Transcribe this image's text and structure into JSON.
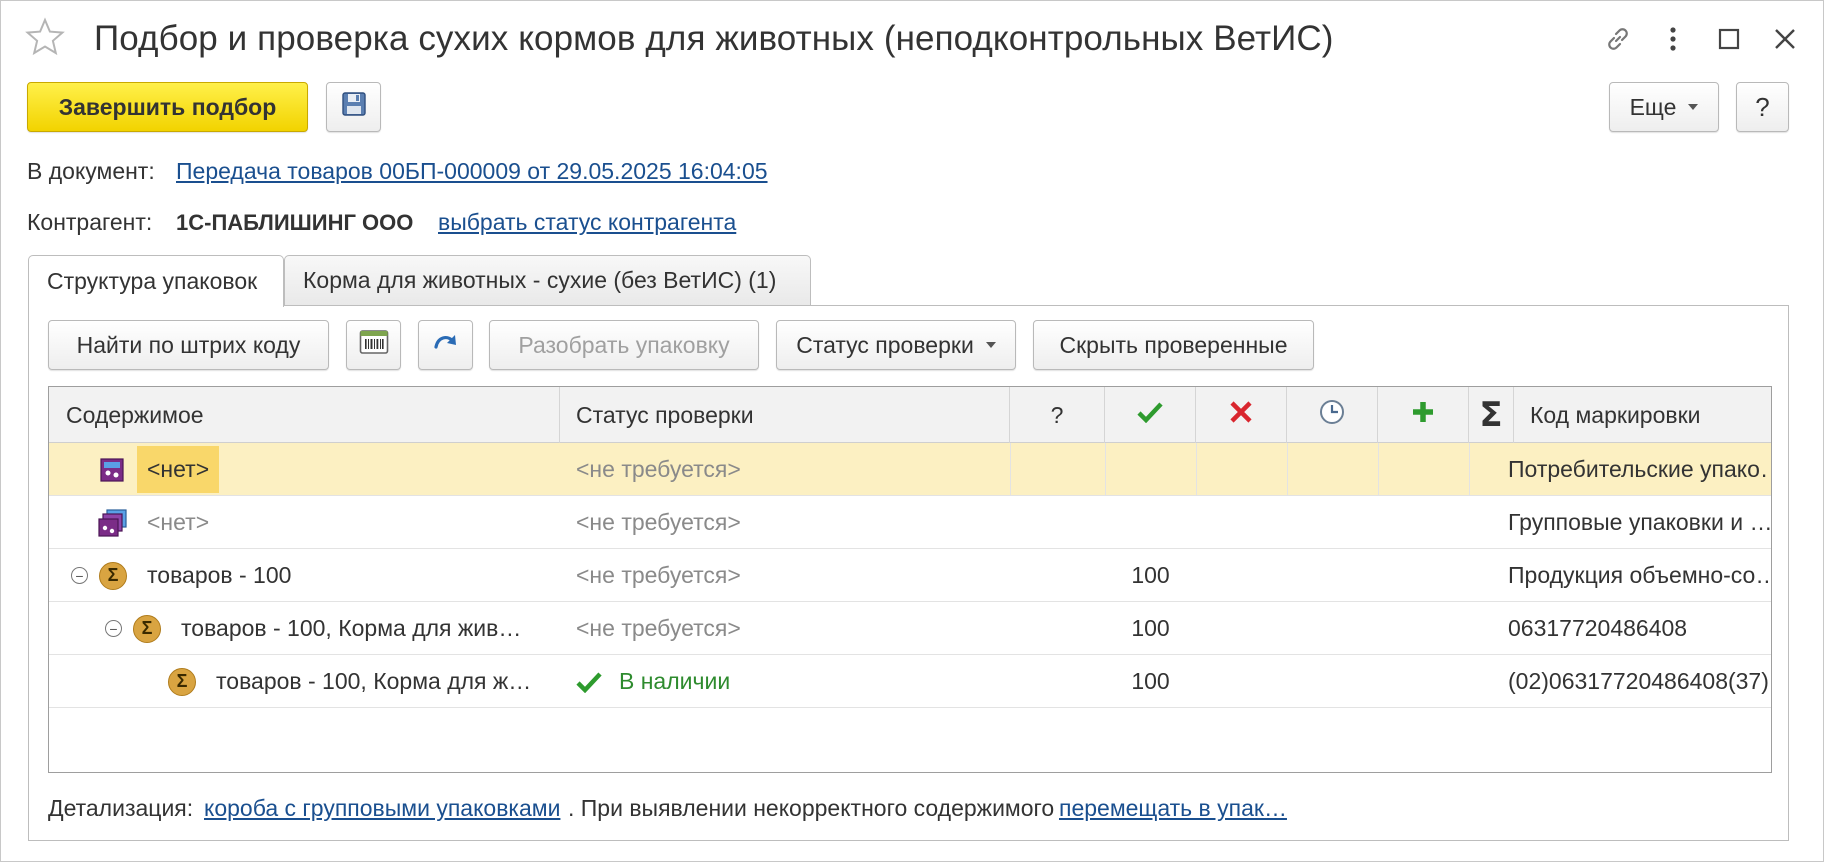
{
  "window": {
    "title": "Подбор и проверка сухих кормов для животных (неподконтрольных ВетИС)"
  },
  "toolbar": {
    "finish_label": "Завершить подбор",
    "more_label": "Еще",
    "help_label": "?"
  },
  "document": {
    "label": "В документ:",
    "link_text": "Передача товаров 00БП-000009 от 29.05.2025 16:04:05"
  },
  "counterparty": {
    "label": "Контрагент:",
    "value": "1С-ПАБЛИШИНГ ООО",
    "link_text": "выбрать статус контрагента"
  },
  "tabs": [
    {
      "label": "Структура упаковок",
      "active": true
    },
    {
      "label": "Корма для животных - сухие (без ВетИС) (1)",
      "active": false
    }
  ],
  "panel_toolbar": {
    "find_barcode_label": "Найти по штрих коду",
    "unpack_label": "Разобрать упаковку",
    "check_status_label": "Статус проверки",
    "hide_checked_label": "Скрыть проверенные"
  },
  "grid": {
    "headers": {
      "content": "Содержимое",
      "status": "Статус проверки",
      "question": "?",
      "ok_icon": "check-icon",
      "fail_icon": "cross-icon",
      "wait_icon": "clock-icon",
      "add_icon": "plus-icon",
      "total_icon": "sigma-icon",
      "marking_code": "Код маркировки"
    },
    "rows": [
      {
        "content": "<нет>",
        "status": "<не требуется>",
        "count": "",
        "code": "Потребительские упако…",
        "icon": "consumer-package-icon",
        "selected": true
      },
      {
        "content": "<нет>",
        "status": "<не требуется>",
        "count": "",
        "code": "Групповые упаковки и …",
        "icon": "group-package-icon",
        "selected": false
      },
      {
        "content": "товаров - 100",
        "status": "<не требуется>",
        "count": "100",
        "code": "Продукция объемно-со…",
        "icon": "sigma-icon",
        "selected": false
      },
      {
        "content": "товаров - 100, Корма для жив…",
        "status": "<не требуется>",
        "count": "100",
        "code": "06317720486408",
        "icon": "sigma-icon",
        "selected": false
      },
      {
        "content": "товаров - 100, Корма для ж…",
        "status": "В наличии",
        "count": "100",
        "code": "(02)06317720486408(37)…",
        "icon": "sigma-icon",
        "selected": false
      }
    ]
  },
  "footer": {
    "detail_label": "Детализация:",
    "detail_link": "короба с групповыми упаковками",
    "middle_text": ". При выявлении некорректного содержимого",
    "move_link": "перемещать в упак…"
  },
  "colors": {
    "primary_button": "#f5dc14",
    "selected_row": "#fcf0c2",
    "link": "#1a4f8f",
    "ok_green": "#2e9b2e",
    "fail_red": "#d9262e"
  }
}
